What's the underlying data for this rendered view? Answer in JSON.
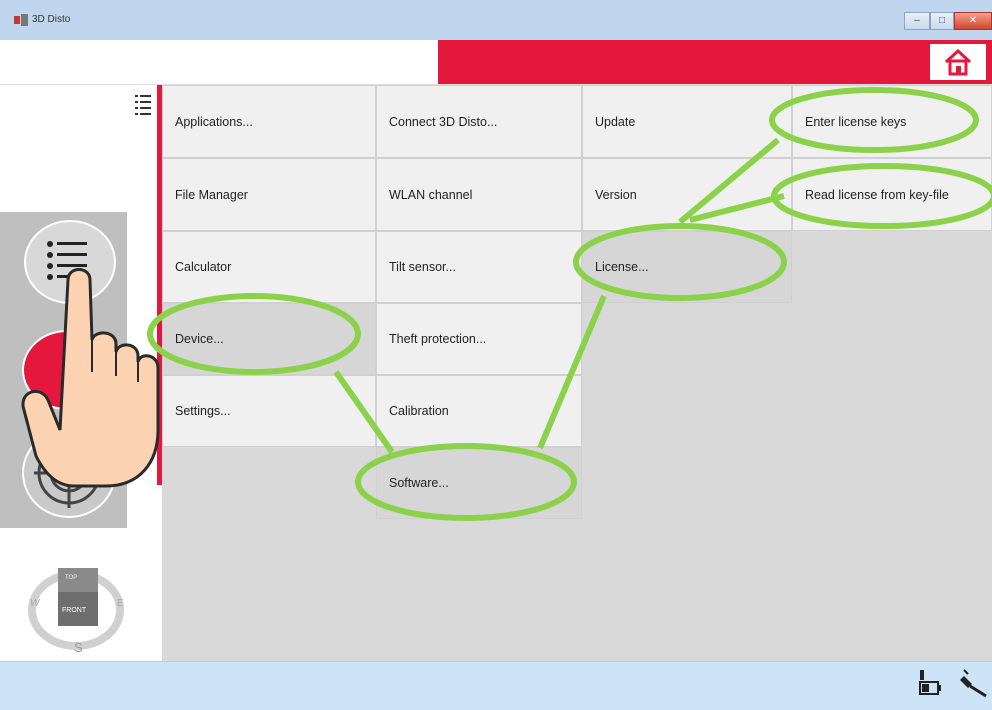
{
  "window": {
    "title": "3D Disto",
    "buttons": [
      "minimize",
      "maximize",
      "close"
    ]
  },
  "header": {
    "home_icon": "home-icon"
  },
  "sidebar": {
    "icons": [
      "list-menu-icon",
      "measure-icon",
      "target-icon",
      "orientation-cube-icon"
    ],
    "cube_top": "TOP",
    "cube_front": "FRONT",
    "compass_w": "W",
    "compass_e": "E",
    "compass_s": "S"
  },
  "menu": {
    "col1": [
      "Applications...",
      "File Manager",
      "Calculator",
      "Device...",
      "Settings..."
    ],
    "col2": [
      "Connect 3D Disto...",
      "WLAN channel",
      "Tilt sensor...",
      "Theft protection...",
      "Calibration",
      "Software..."
    ],
    "col3": [
      "Update",
      "Version",
      "License..."
    ],
    "col4": [
      "Enter license keys",
      "Read license from key-file"
    ]
  },
  "footer": {
    "icons": [
      "battery-icon",
      "plug-icon"
    ]
  },
  "annotation": {
    "highlight_color": "#8cd14a",
    "hand_icon": "pointing-hand-icon"
  }
}
